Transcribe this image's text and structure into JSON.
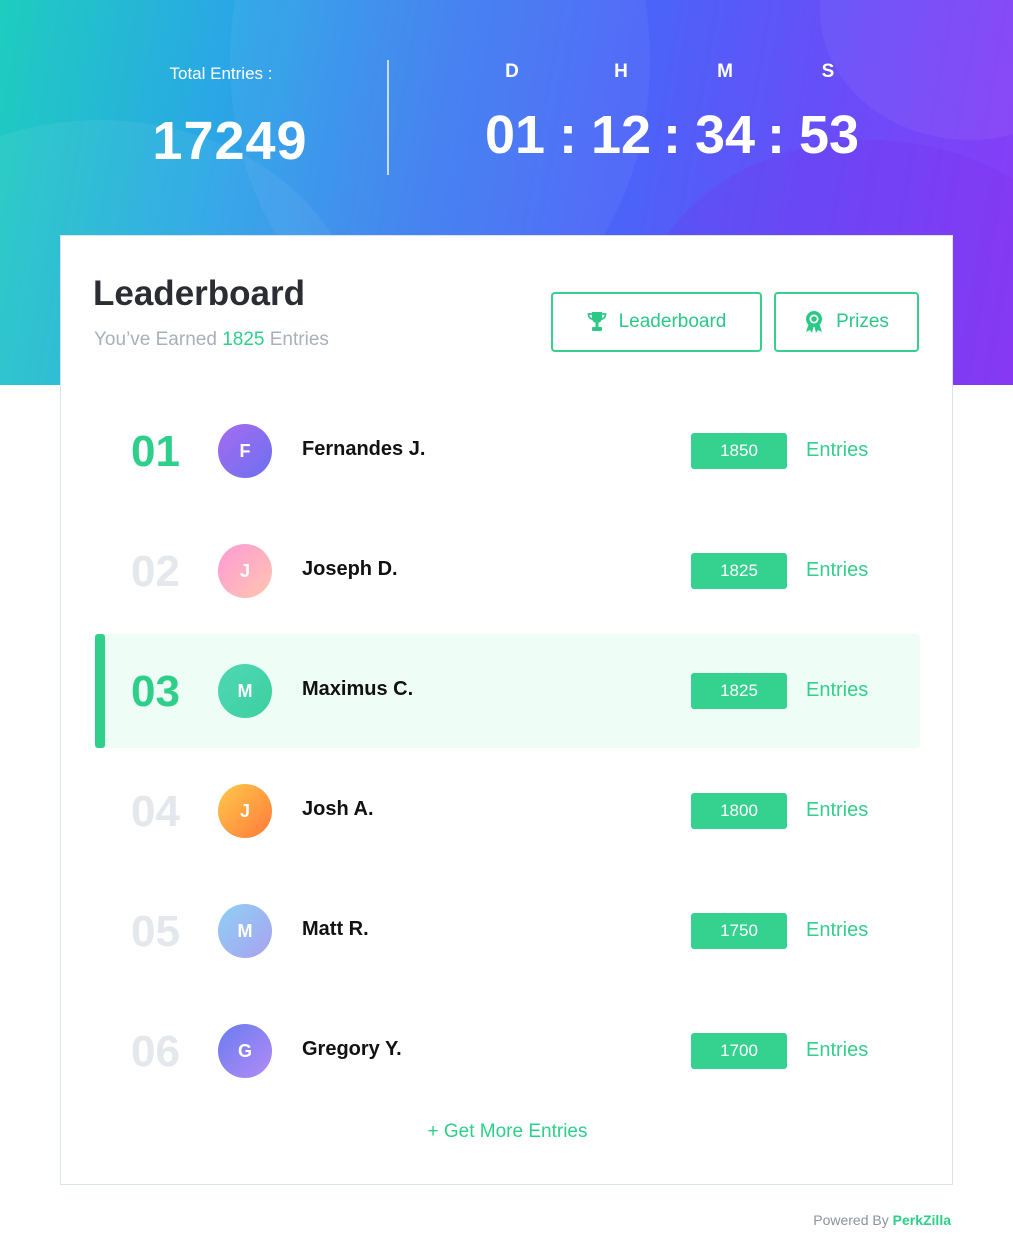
{
  "header": {
    "total_label": "Total Entries :",
    "total_value": "17249",
    "countdown": {
      "labels": [
        "D",
        "H",
        "M",
        "S"
      ],
      "values": [
        "01",
        "12",
        "34",
        "53"
      ],
      "separator": ":"
    }
  },
  "card": {
    "title": "Leaderboard",
    "subtitle_prefix": "You’ve Earned",
    "subtitle_count": "1825",
    "subtitle_suffix": "Entries",
    "tabs": {
      "leaderboard": "Leaderboard",
      "prizes": "Prizes"
    },
    "entries_word": "Entries",
    "rows": [
      {
        "rank": "01",
        "initial": "F",
        "name": "Fernandes J.",
        "score": "1850"
      },
      {
        "rank": "02",
        "initial": "J",
        "name": "Joseph D.",
        "score": "1825"
      },
      {
        "rank": "03",
        "initial": "M",
        "name": "Maximus C.",
        "score": "1825"
      },
      {
        "rank": "04",
        "initial": "J",
        "name": "Josh A.",
        "score": "1800"
      },
      {
        "rank": "05",
        "initial": "M",
        "name": "Matt R.",
        "score": "1750"
      },
      {
        "rank": "06",
        "initial": "G",
        "name": "Gregory Y.",
        "score": "1700"
      }
    ],
    "get_more": "+ Get More Entries"
  },
  "footer": {
    "powered_by": "Powered By",
    "brand": "PerkZilla"
  },
  "colors": {
    "accent_green": "#2ecf8a",
    "badge_green": "#35d18e",
    "highlight_row": "#eefdf5"
  },
  "icons": {
    "leaderboard_tab": "trophy-icon",
    "prizes_tab": "award-ribbon-icon"
  }
}
